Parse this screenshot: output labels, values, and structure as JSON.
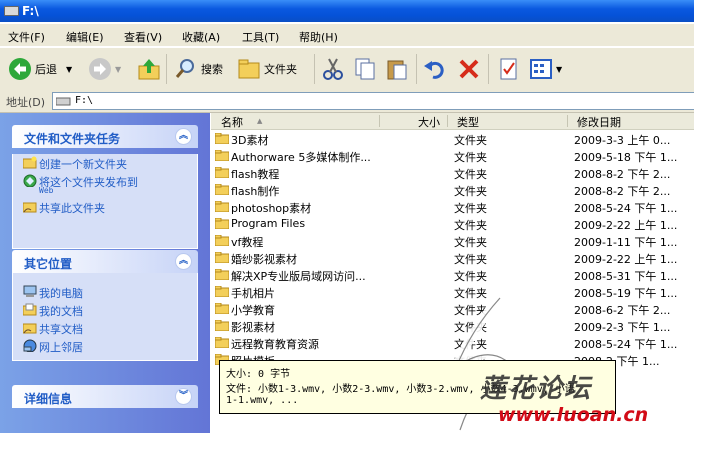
{
  "window": {
    "title": "F:\\"
  },
  "menu": [
    "文件(F)",
    "编辑(E)",
    "查看(V)",
    "收藏(A)",
    "工具(T)",
    "帮助(H)"
  ],
  "toolbar": {
    "back_label": "后退",
    "search_label": "搜索",
    "folders_label": "文件夹"
  },
  "address": {
    "label": "地址(D)",
    "value": "F:\\"
  },
  "panels": {
    "tasks": {
      "title": "文件和文件夹任务",
      "items": [
        "创建一个新文件夹",
        "将这个文件夹发布到",
        "共享此文件夹"
      ],
      "sub": "Web"
    },
    "places": {
      "title": "其它位置",
      "items": [
        "我的电脑",
        "我的文档",
        "共享文档",
        "网上邻居"
      ]
    },
    "details": {
      "title": "详细信息"
    }
  },
  "columns": {
    "name": "名称",
    "size": "大小",
    "type": "类型",
    "modified": "修改日期"
  },
  "files": [
    {
      "name": "3D素材",
      "type": "文件夹",
      "date": "2009-3-3 上午 0..."
    },
    {
      "name": "Authorware 5多媒体制作...",
      "type": "文件夹",
      "date": "2009-5-18 下午 1..."
    },
    {
      "name": "flash教程",
      "type": "文件夹",
      "date": "2008-8-2 下午 2..."
    },
    {
      "name": "flash制作",
      "type": "文件夹",
      "date": "2008-8-2 下午 2..."
    },
    {
      "name": "photoshop素材",
      "type": "文件夹",
      "date": "2008-5-24 下午 1..."
    },
    {
      "name": "Program Files",
      "type": "文件夹",
      "date": "2009-2-22 上午 1..."
    },
    {
      "name": "vf教程",
      "type": "文件夹",
      "date": "2009-1-11 下午 1..."
    },
    {
      "name": "婚纱影视素材",
      "type": "文件夹",
      "date": "2009-2-22 上午 1..."
    },
    {
      "name": "解决XP专业版局域网访问...",
      "type": "文件夹",
      "date": "2008-5-31 下午 1..."
    },
    {
      "name": "手机相片",
      "type": "文件夹",
      "date": "2008-5-19 下午 1..."
    },
    {
      "name": "小学教育",
      "type": "文件夹",
      "date": "2008-6-2 下午 2..."
    },
    {
      "name": "影视素材",
      "type": "文件夹",
      "date": "2009-2-3 下午 1..."
    },
    {
      "name": "远程教育教育资源",
      "type": "文件夹",
      "date": "2008-5-24 下午 1..."
    },
    {
      "name": "照片模板",
      "type": "文件夹",
      "date": "2008-2 下午 1..."
    }
  ],
  "tooltip": {
    "line1": "大小: 0 字节",
    "line2": "文件: 小数1-3.wmv, 小数2-3.wmv, 小数3-2.wmv, 小数4-3.wmv, 小语",
    "line3": "1-1.wmv, ..."
  },
  "watermark": {
    "text": "莲花论坛",
    "url": "www.luoan.cn"
  },
  "colors": {
    "titlebar": "#0b59e0",
    "taskpane": "#6f8fe0",
    "link": "#215dc6",
    "tooltip": "#ffffe1"
  }
}
